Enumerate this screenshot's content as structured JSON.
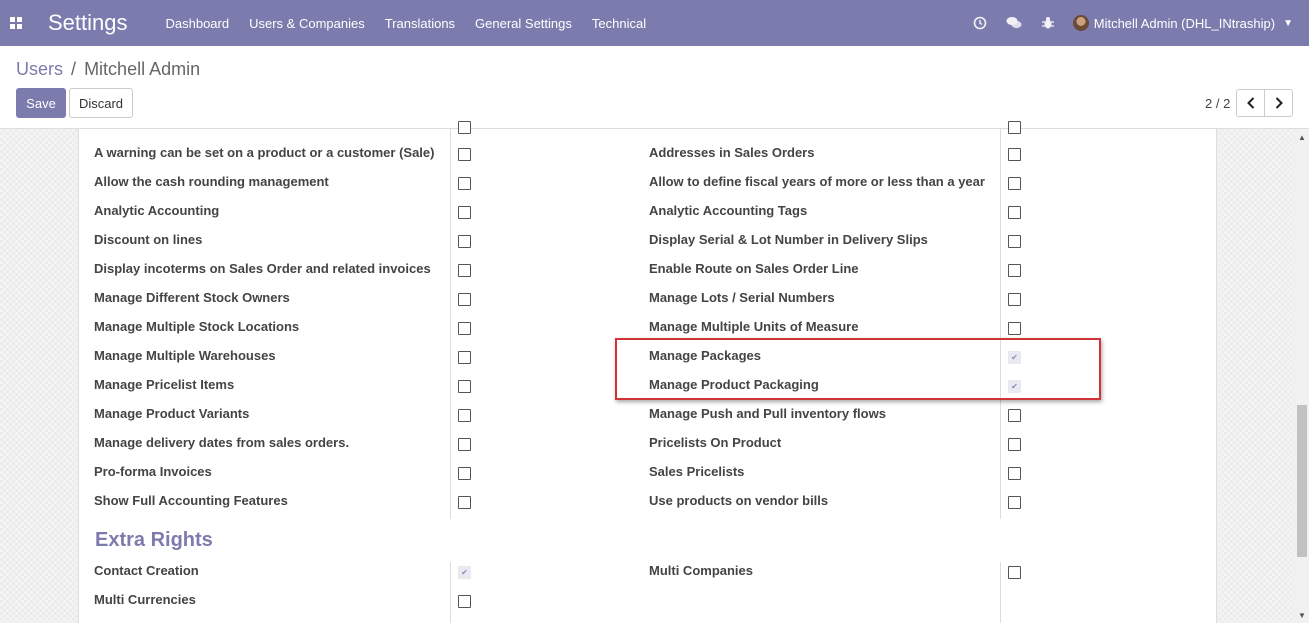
{
  "navbar": {
    "app_title": "Settings",
    "menu": [
      "Dashboard",
      "Users & Companies",
      "Translations",
      "General Settings",
      "Technical"
    ],
    "user_name": "Mitchell Admin (DHL_INtraship)",
    "accent_color": "#7c7bad"
  },
  "breadcrumb": {
    "parent": "Users",
    "separator": "/",
    "current": "Mitchell Admin"
  },
  "buttons": {
    "save": "Save",
    "discard": "Discard"
  },
  "pager": {
    "value": "2 / 2"
  },
  "left_rows": [
    {
      "label": "A warning can be set on a product or a customer (Sale)",
      "checked": false
    },
    {
      "label": "Allow the cash rounding management",
      "checked": false
    },
    {
      "label": "Analytic Accounting",
      "checked": false
    },
    {
      "label": "Discount on lines",
      "checked": false
    },
    {
      "label": "Display incoterms on Sales Order and related invoices",
      "checked": false
    },
    {
      "label": "Manage Different Stock Owners",
      "checked": false
    },
    {
      "label": "Manage Multiple Stock Locations",
      "checked": false
    },
    {
      "label": "Manage Multiple Warehouses",
      "checked": false
    },
    {
      "label": "Manage Pricelist Items",
      "checked": false
    },
    {
      "label": "Manage Product Variants",
      "checked": false
    },
    {
      "label": "Manage delivery dates from sales orders.",
      "checked": false
    },
    {
      "label": "Pro-forma Invoices",
      "checked": false
    },
    {
      "label": "Show Full Accounting Features",
      "checked": false
    }
  ],
  "right_rows": [
    {
      "label": "Addresses in Sales Orders",
      "checked": false
    },
    {
      "label": "Allow to define fiscal years of more or less than a year",
      "checked": false
    },
    {
      "label": "Analytic Accounting Tags",
      "checked": false
    },
    {
      "label": "Display Serial & Lot Number in Delivery Slips",
      "checked": false
    },
    {
      "label": "Enable Route on Sales Order Line",
      "checked": false
    },
    {
      "label": "Manage Lots / Serial Numbers",
      "checked": false
    },
    {
      "label": "Manage Multiple Units of Measure",
      "checked": false
    },
    {
      "label": "Manage Packages",
      "checked": true
    },
    {
      "label": "Manage Product Packaging",
      "checked": true
    },
    {
      "label": "Manage Push and Pull inventory flows",
      "checked": false
    },
    {
      "label": "Pricelists On Product",
      "checked": false
    },
    {
      "label": "Sales Pricelists",
      "checked": false
    },
    {
      "label": "Use products on vendor bills",
      "checked": false
    }
  ],
  "extra_rights": {
    "title": "Extra Rights",
    "left_rows": [
      {
        "label": "Contact Creation",
        "checked": true
      },
      {
        "label": "Multi Currencies",
        "checked": false
      }
    ],
    "right_rows": [
      {
        "label": "Multi Companies",
        "checked": false
      }
    ]
  },
  "icons": [
    "apps-icon",
    "clock-icon",
    "chat-icon",
    "bug-icon",
    "avatar",
    "chevron-left-icon",
    "chevron-right-icon",
    "check-icon"
  ]
}
